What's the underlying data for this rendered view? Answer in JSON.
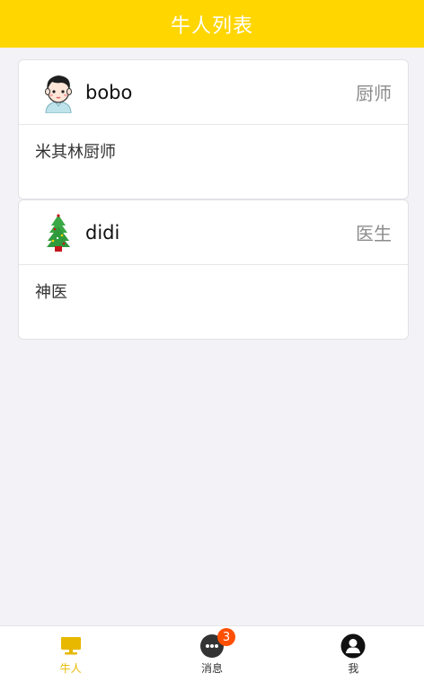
{
  "header": {
    "title": "牛人列表"
  },
  "colors": {
    "brand": "#ffd600",
    "background": "#f2f2f7",
    "active_tab": "#e8b800",
    "badge": "#ff4f00"
  },
  "cards": [
    {
      "avatar_icon": "boy-avatar-icon",
      "name": "bobo",
      "role": "厨师",
      "description": "米其林厨师"
    },
    {
      "avatar_icon": "christmas-tree-icon",
      "name": "didi",
      "role": "医生",
      "description": "神医"
    }
  ],
  "tabbar": {
    "items": [
      {
        "label": "牛人",
        "icon": "monitor-icon",
        "active": true
      },
      {
        "label": "消息",
        "icon": "chat-bubble-icon",
        "badge": "3"
      },
      {
        "label": "我",
        "icon": "user-icon"
      }
    ]
  }
}
